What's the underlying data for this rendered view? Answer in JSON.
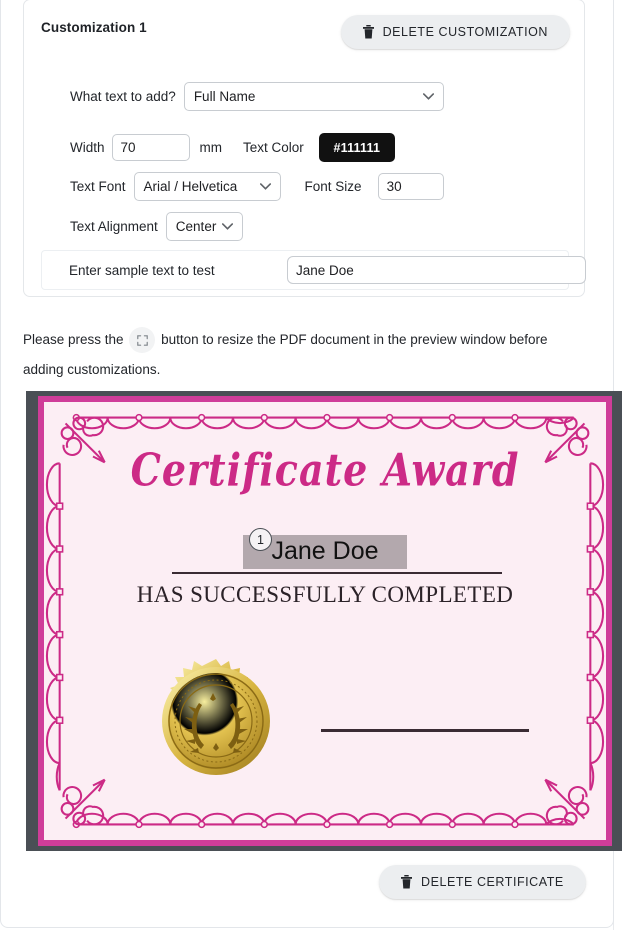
{
  "customization": {
    "title": "Customization 1",
    "delete_label": "DELETE CUSTOMIZATION",
    "delete_icon": "trash-icon",
    "fields": {
      "what_text_label": "What text to add?",
      "what_text_value": "Full Name",
      "width_label": "Width",
      "width_value": "70",
      "width_unit": "mm",
      "text_color_label": "Text Color",
      "text_color_value": "#111111",
      "text_font_label": "Text Font",
      "text_font_value": "Arial / Helvetica",
      "font_size_label": "Font Size",
      "font_size_value": "30",
      "text_alignment_label": "Text Alignment",
      "text_alignment_value": "Center",
      "sample_label": "Enter sample text to test",
      "sample_value": "Jane Doe"
    }
  },
  "instruction": {
    "before": "Please press the",
    "icon": "fullscreen-expand-icon",
    "after": "button to resize the PDF document in the preview window before adding customizations."
  },
  "certificate": {
    "title": "Certificate Award",
    "name_field": "Jane Doe",
    "badge_number": "1",
    "subtitle": "HAS SUCCESSFULLY COMPLETED",
    "seal_icon": "gold-award-seal",
    "colors": {
      "border": "#cf3d99",
      "paper": "#fceef4",
      "mat": "#4a4f55",
      "title_text": "#cc2a86",
      "highlight": "#b3a8ad"
    }
  },
  "footer": {
    "delete_label": "DELETE CERTIFICATE",
    "delete_icon": "trash-icon"
  }
}
